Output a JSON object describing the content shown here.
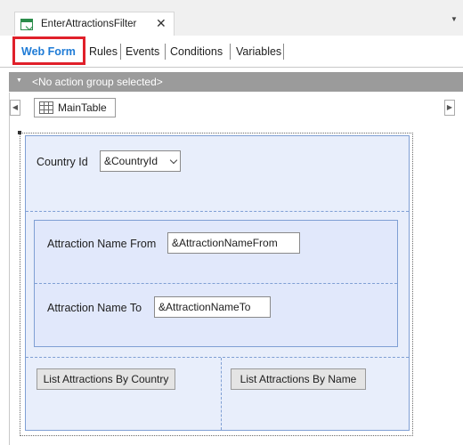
{
  "document_tab": {
    "title": "EnterAttractionsFilter",
    "close_glyph": "✕",
    "icon": "webpanel-icon"
  },
  "overflow_glyph": "▼",
  "subtabs": [
    {
      "label": "Web Form",
      "active": true
    },
    {
      "label": "Rules",
      "active": false
    },
    {
      "label": "Events",
      "active": false
    },
    {
      "label": "Conditions",
      "active": false
    },
    {
      "label": "Variables",
      "active": false
    }
  ],
  "action_group": {
    "caret": "▼",
    "text": "<No action group selected>"
  },
  "navigation": {
    "left_glyph": "◀",
    "right_glyph": "▶",
    "maintable_label": "MainTable"
  },
  "form": {
    "country_label": "Country Id",
    "country_value": "&CountryId",
    "name_from_label": "Attraction Name From",
    "name_from_value": "&AttractionNameFrom",
    "name_to_label": "Attraction Name To",
    "name_to_value": "&AttractionNameTo",
    "button_by_country": "List Attractions By Country",
    "button_by_name": "List Attractions By Name"
  },
  "colors": {
    "active_tab": "#1e7bd6",
    "highlight": "#e0202a",
    "table_fill": "#e8eefb",
    "table_border": "#7f9fd4",
    "action_bar": "#9b9b9b"
  }
}
